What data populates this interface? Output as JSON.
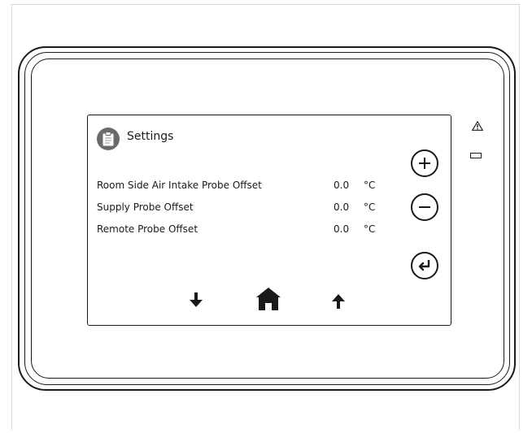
{
  "screen": {
    "title": "Settings",
    "title_icon": "clipboard-icon",
    "rows": [
      {
        "label": "Room Side Air Intake Probe Offset",
        "value": "0.0",
        "unit": "°C"
      },
      {
        "label": "Supply Probe Offset",
        "value": "0.0",
        "unit": "°C"
      },
      {
        "label": "Remote Probe Offset",
        "value": "0.0",
        "unit": "°C"
      }
    ]
  },
  "controls": {
    "increase_icon": "plus-icon",
    "decrease_icon": "minus-icon",
    "enter_icon": "enter-icon",
    "down_icon": "arrow-down-icon",
    "home_icon": "home-icon",
    "up_icon": "arrow-up-icon"
  },
  "device": {
    "warning_icon": "warning-icon",
    "status_led": "status-led"
  },
  "colors": {
    "outline": "#1a1a1a",
    "title_icon_bg": "#6b6b6b",
    "background": "#ffffff"
  }
}
